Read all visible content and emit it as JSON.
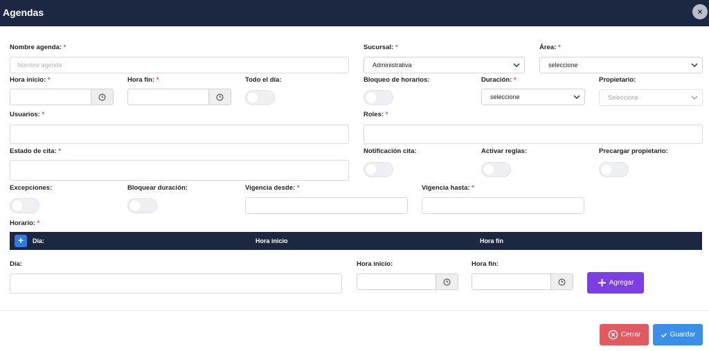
{
  "window": {
    "title": "Agendas",
    "close_label": "×"
  },
  "fields": {
    "nombre_agenda": {
      "label": "Nombre agenda:",
      "placeholder": "Nombre agenda",
      "value": ""
    },
    "sucursal": {
      "label": "Sucursal:",
      "value": "Administrativa"
    },
    "area": {
      "label": "Área:",
      "value": "seleccione"
    },
    "hora_inicio": {
      "label": "Hora inicio:",
      "value": ""
    },
    "hora_fin": {
      "label": "Hora fin:",
      "value": ""
    },
    "todo_el_dia": {
      "label": "Todo el día:",
      "on": false
    },
    "bloqueo_horarios": {
      "label": "Bloqueo de horarios:",
      "on": false
    },
    "duracion": {
      "label": "Duración:",
      "value": "seleccione"
    },
    "propietario": {
      "label": "Propietario:",
      "value": "Seleccione"
    },
    "usuarios": {
      "label": "Usuarios:",
      "value": ""
    },
    "roles": {
      "label": "Roles:",
      "value": ""
    },
    "estado_cita": {
      "label": "Estado de cita:",
      "value": ""
    },
    "notificacion_cita": {
      "label": "Notificación cita:",
      "on": false
    },
    "activar_reglas": {
      "label": "Activar reglas:",
      "on": false
    },
    "precargar_propietario": {
      "label": "Precargar propietario:",
      "on": false
    },
    "excepciones": {
      "label": "Excepciones:",
      "on": false
    },
    "bloquear_duracion": {
      "label": "Bloquear duración:",
      "on": false
    },
    "vigencia_desde": {
      "label": "Vigencia desde:",
      "value": ""
    },
    "vigencia_hasta": {
      "label": "Vigencia hasta:",
      "value": ""
    },
    "horario": {
      "label": "Horario:"
    }
  },
  "required_mark": "*",
  "schedule_table": {
    "add_label": "+",
    "columns": [
      "Día:",
      "Hora inicio",
      "Hora fin"
    ]
  },
  "schedule_form": {
    "dia": {
      "label": "Día:",
      "value": ""
    },
    "hora_inicio": {
      "label": "Hora inicio:",
      "value": ""
    },
    "hora_fin": {
      "label": "Hora fin:",
      "value": ""
    },
    "add_button": "Agregar"
  },
  "footer": {
    "close_button": "Cerrar",
    "save_button": "Guardar"
  },
  "colors": {
    "header": "#1c2841",
    "required": "#d9534f",
    "add": "#7b3fe4",
    "close": "#e05a5f",
    "save": "#3b8fe9"
  }
}
